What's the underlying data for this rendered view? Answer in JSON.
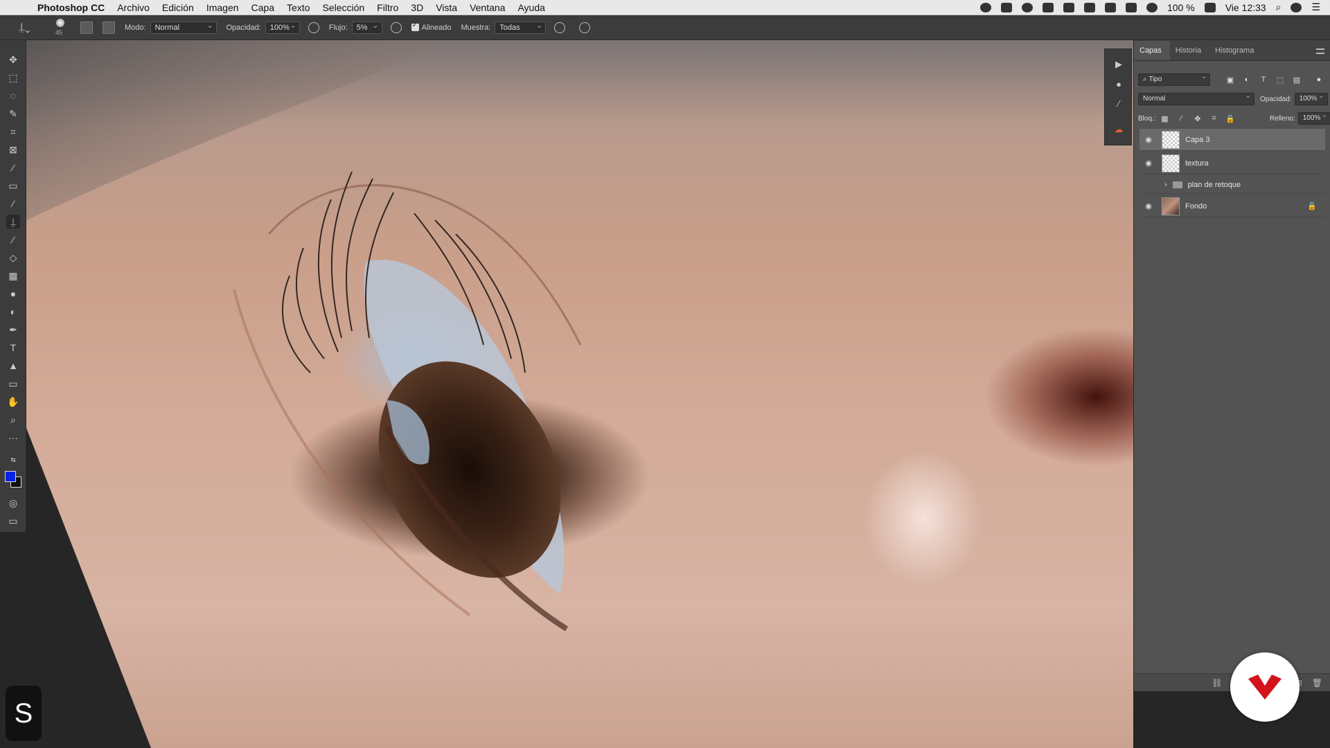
{
  "menubar": {
    "app_name": "Photoshop CC",
    "items": [
      "Archivo",
      "Edición",
      "Imagen",
      "Capa",
      "Texto",
      "Selección",
      "Filtro",
      "3D",
      "Vista",
      "Ventana",
      "Ayuda"
    ],
    "battery": "100 %",
    "clock": "Vie 12:33"
  },
  "options": {
    "brush_size": "45",
    "mode_label": "Modo:",
    "mode_value": "Normal",
    "opacity_label": "Opacidad:",
    "opacity_value": "100%",
    "flow_label": "Flujo:",
    "flow_value": "5%",
    "aligned_label": "Alineado",
    "sample_label": "Muestra:",
    "sample_value": "Todas"
  },
  "toolbar": {
    "foreground_color": "#0a22e6",
    "background_color": "#111111"
  },
  "layers_panel": {
    "tabs": [
      "Capas",
      "Historia",
      "Histograma"
    ],
    "filter_value": "Tipo",
    "blend_mode": "Normal",
    "opacity_label": "Opacidad:",
    "opacity_value": "100%",
    "lock_label": "Bloq.:",
    "fill_label": "Relleno:",
    "fill_value": "100%",
    "layers": [
      {
        "name": "Capa 3",
        "visible": true,
        "selected": true
      },
      {
        "name": "textura",
        "visible": true
      },
      {
        "name": "plan de retoque",
        "visible": false,
        "type": "group"
      },
      {
        "name": "Fondo",
        "visible": true,
        "locked": true
      }
    ]
  },
  "watermark": {
    "letter": "S"
  }
}
